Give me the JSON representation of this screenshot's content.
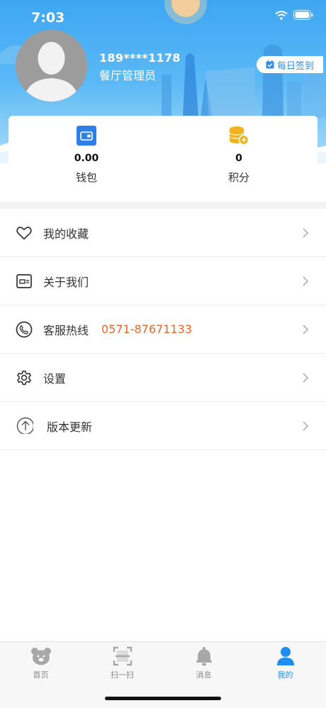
{
  "status": {
    "time": "7:03"
  },
  "profile": {
    "phone": "189****1178",
    "role": "餐厅管理员",
    "signin_label": "每日签到"
  },
  "stats": [
    {
      "value": "0.00",
      "label": "钱包",
      "icon": "wallet-icon"
    },
    {
      "value": "0",
      "label": "积分",
      "icon": "coins-icon"
    }
  ],
  "menu": [
    {
      "label": "我的收藏",
      "icon": "heart-icon"
    },
    {
      "label": "关于我们",
      "icon": "info-card-icon"
    },
    {
      "label": "客服热线",
      "icon": "phone-icon",
      "phone": "0571-87671133"
    },
    {
      "label": "设置",
      "icon": "gear-icon"
    },
    {
      "label": "版本更新",
      "icon": "upload-arrow-icon"
    }
  ],
  "tabs": [
    {
      "label": "首页",
      "icon": "bear-icon"
    },
    {
      "label": "扫一扫",
      "icon": "scan-icon"
    },
    {
      "label": "消息",
      "icon": "bell-icon"
    },
    {
      "label": "我的",
      "icon": "person-icon"
    }
  ],
  "colors": {
    "accent": "#1e8ff0",
    "hotline": "#e8662b",
    "header_top": "#3ea6f2"
  }
}
